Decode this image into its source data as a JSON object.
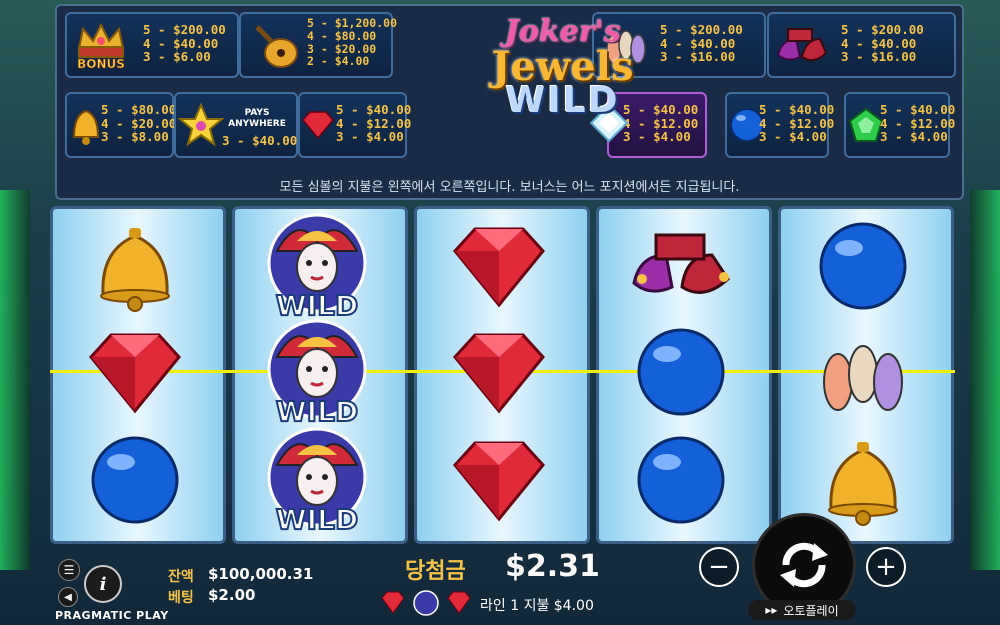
{
  "paytable": {
    "bonus": {
      "lines": [
        "5 - $200.00",
        "4 - $40.00",
        "3 - $6.00"
      ],
      "icon": "crown-bonus-icon",
      "icon_text": "BONUS"
    },
    "lute": {
      "lines": [
        "5 - $1,200.00",
        "4 - $80.00",
        "3 - $20.00",
        "2 - $4.00"
      ],
      "icon": "lute-icon"
    },
    "pins": {
      "lines": [
        "5 - $200.00",
        "4 - $40.00",
        "3 - $16.00"
      ],
      "icon": "juggling-pins-icon"
    },
    "shoes": {
      "lines": [
        "5 - $200.00",
        "4 - $40.00",
        "3 - $16.00"
      ],
      "icon": "jester-shoes-icon"
    },
    "bell": {
      "lines": [
        "5 - $80.00",
        "4 - $20.00",
        "3 - $8.00"
      ],
      "icon": "bell-icon"
    },
    "star": {
      "lines": [
        "3 - $40.00"
      ],
      "pays_label": "PAYS\nANYWHERE",
      "icon": "star-scatter-icon"
    },
    "ruby": {
      "lines": [
        "5 - $40.00",
        "4 - $12.00",
        "3 - $4.00"
      ],
      "icon": "red-gem-icon"
    },
    "diamond": {
      "lines": [
        "5 - $40.00",
        "4 - $12.00",
        "3 - $4.00"
      ],
      "icon": "white-diamond-icon"
    },
    "sapphire": {
      "lines": [
        "5 - $40.00",
        "4 - $12.00",
        "3 - $4.00"
      ],
      "icon": "blue-orb-icon"
    },
    "emerald": {
      "lines": [
        "5 - $40.00",
        "4 - $12.00",
        "3 - $4.00"
      ],
      "icon": "green-gem-icon"
    },
    "info": "모든 심볼의 지불은 왼쪽에서 오른쪽입니다. 보너스는 어느 포지션에서든 지급됩니다."
  },
  "logo": {
    "line1": "Joker's",
    "line2": "Jewels",
    "line3": "WILD"
  },
  "reels": [
    [
      "bell",
      "ruby",
      "orb"
    ],
    [
      "wild",
      "wild",
      "wild"
    ],
    [
      "ruby",
      "ruby",
      "ruby"
    ],
    [
      "shoes",
      "orb",
      "orb"
    ],
    [
      "orb",
      "pins",
      "bell"
    ]
  ],
  "wild_label": "WILD",
  "bottom": {
    "balance_label": "잔액",
    "balance_value": "$100,000.31",
    "bet_label": "베팅",
    "bet_value": "$2.00",
    "win_label": "당첨금",
    "win_value": "$2.31",
    "line_win_text": "라인 1 지불 $4.00",
    "autoplay_label": "오토플레이",
    "brand": "PRAGMATIC PLAY",
    "minus": "−",
    "plus": "+",
    "info_glyph": "i"
  },
  "colors": {
    "gold": "#f6c244",
    "payline": "#f1f000",
    "panel": "#1a2c45"
  }
}
